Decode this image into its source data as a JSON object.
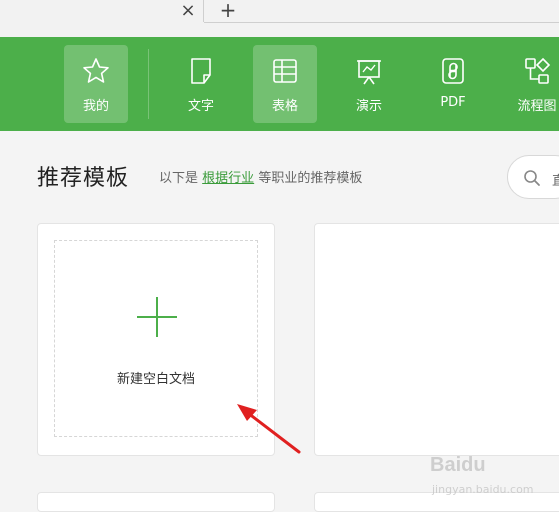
{
  "tabs": {
    "close_glyph": "×",
    "new_glyph": "+"
  },
  "toolbar": {
    "accent": "#4caf4a",
    "items": [
      {
        "label": "我的",
        "icon": "star-icon",
        "active": true
      },
      {
        "label": "文字",
        "icon": "document-icon",
        "active": false
      },
      {
        "label": "表格",
        "icon": "table-icon",
        "active": true
      },
      {
        "label": "演示",
        "icon": "presentation-icon",
        "active": false
      },
      {
        "label": "PDF",
        "icon": "pdf-icon",
        "active": false
      },
      {
        "label": "流程图",
        "icon": "flowchart-icon",
        "active": false
      }
    ]
  },
  "main": {
    "title": "推荐模板",
    "subtitle_prefix": "以下是",
    "subtitle_link": "根据行业",
    "subtitle_suffix": "等职业的推荐模板",
    "search": {
      "icon": "search-icon",
      "text": "直"
    },
    "new_doc_label": "新建空白文档",
    "plus_color": "#4caf4a"
  },
  "annotation": {
    "arrow_color": "#e02020",
    "icon": "red-arrow-icon"
  },
  "watermark": {
    "brand": "Baidu",
    "sub": "jingyan.baidu.com"
  }
}
